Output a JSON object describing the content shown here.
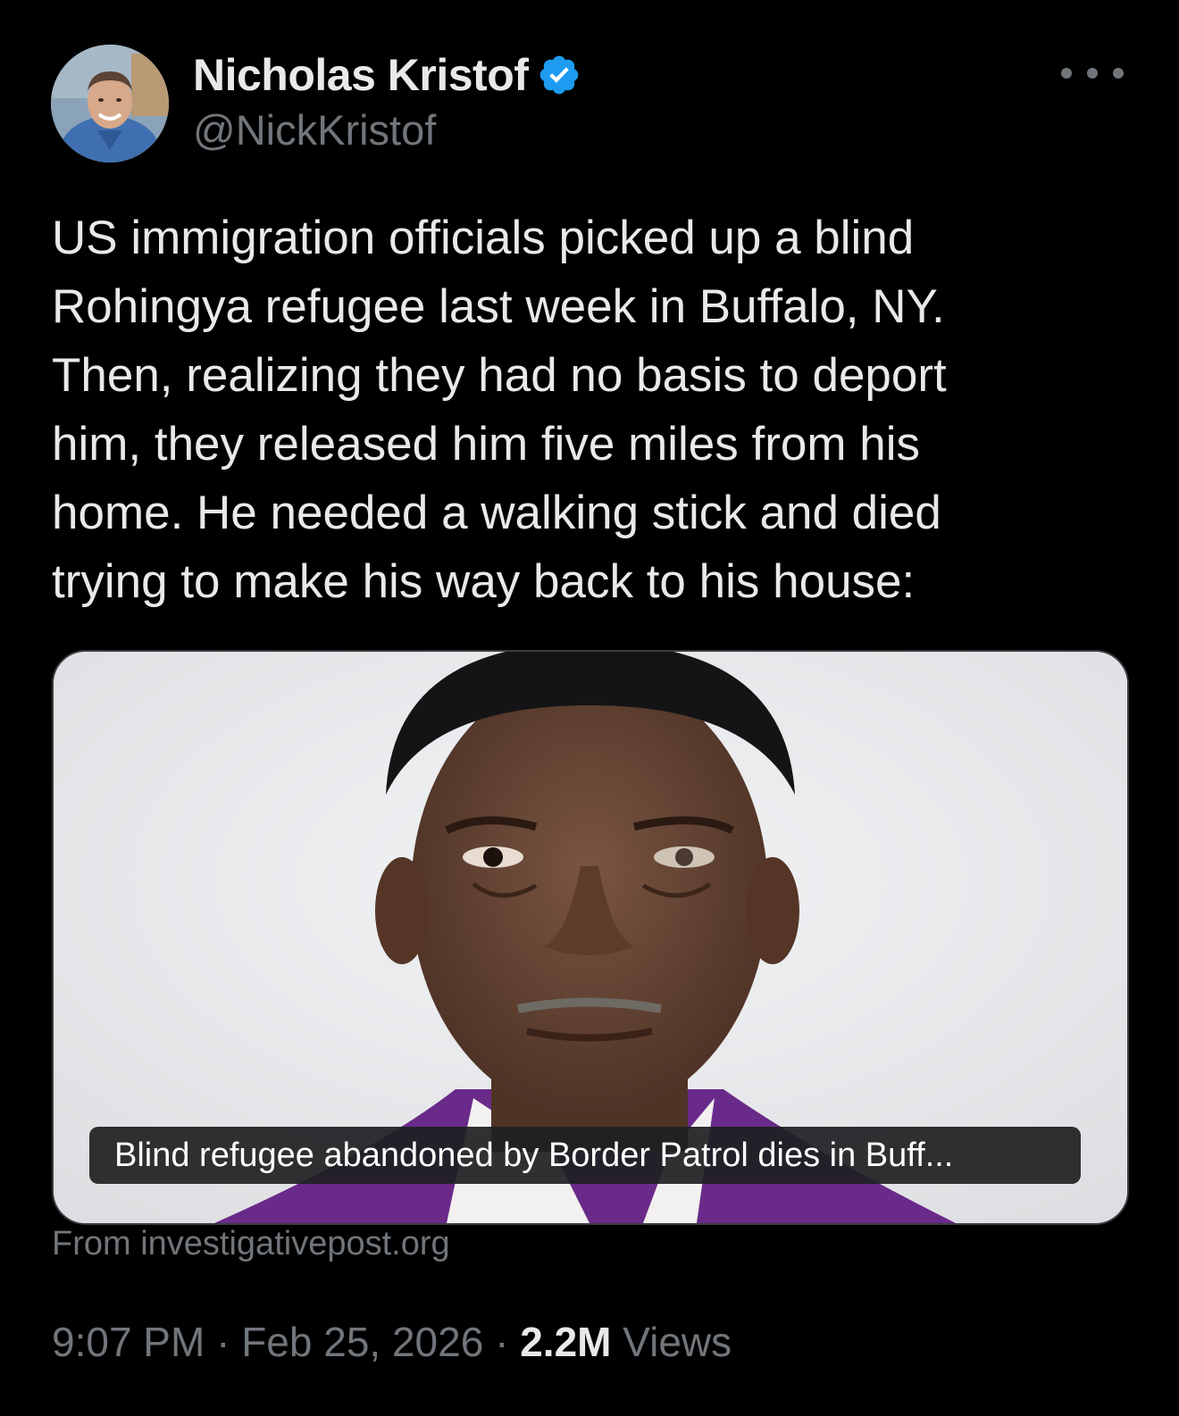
{
  "author": {
    "display_name": "Nicholas Kristof",
    "handle": "@NickKristof",
    "verified": true,
    "avatar_icon": "avatar-photo"
  },
  "more_icon": "more-dots-icon",
  "tweet": {
    "lines": [
      "US immigration officials picked up a blind",
      "Rohingya refugee last week in Buffalo, NY.",
      "Then, realizing they had no basis to deport",
      "him, they released him five miles from his",
      "home. He needed a walking stick and died",
      "trying to make his way back to his house:"
    ]
  },
  "card": {
    "title": "Blind refugee abandoned by Border Patrol dies in Buff...",
    "source": "From investigativepost.org"
  },
  "meta": {
    "time": "9:07 PM",
    "sep1": " · ",
    "date": "Feb 25, 2026",
    "sep2": " · ",
    "views_count": "2.2M",
    "views_label": " Views"
  },
  "colors": {
    "background": "#000000",
    "text_primary": "#e7e9ea",
    "text_secondary": "#71767b",
    "verified_blue": "#1d9bf0",
    "card_border": "#3a3d41"
  }
}
